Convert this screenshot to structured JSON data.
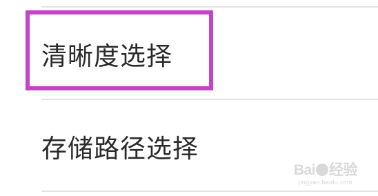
{
  "settings": {
    "items": [
      {
        "label": "清晰度选择"
      },
      {
        "label": "存储路径选择"
      }
    ]
  },
  "highlight": {
    "color": "#c543c8"
  },
  "watermark": {
    "brand_left": "Bai",
    "brand_right": "经验",
    "url": "jingyan.baidu.com"
  }
}
